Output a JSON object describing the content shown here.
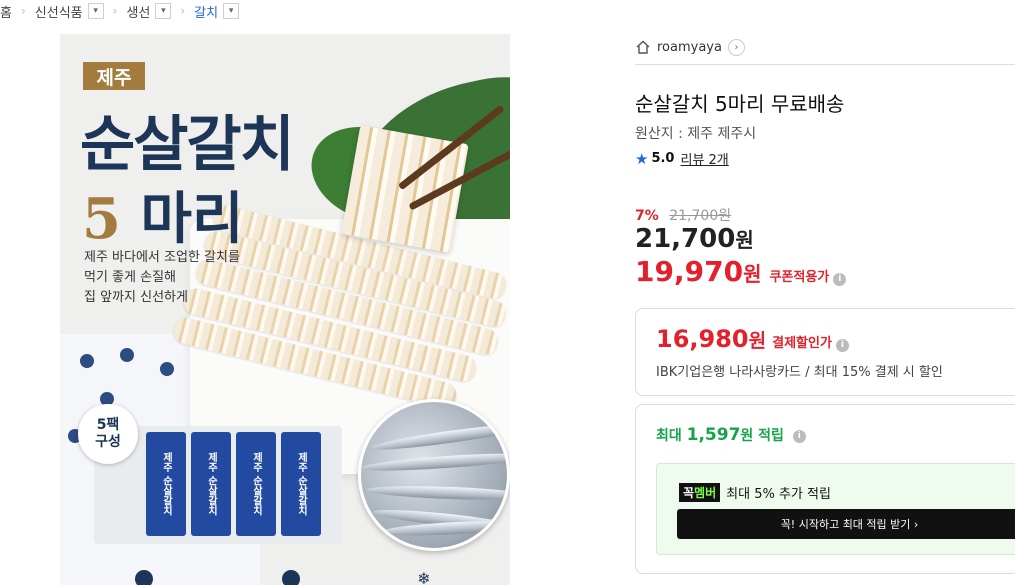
{
  "breadcrumb": {
    "items": [
      "홈",
      "신선식품",
      "생선",
      "갈치"
    ]
  },
  "hero": {
    "badge": "제주",
    "title": "순살갈치",
    "subtitle_number": "5",
    "subtitle_text": "마리",
    "tagline": [
      "제주 바다에서 조업한 갈치를",
      "먹기 좋게 손질해",
      "집 앞까지 신선하게"
    ],
    "pack_badge": [
      "5팩",
      "구성"
    ],
    "pack_label": "제주 순살갈치"
  },
  "product": {
    "shop_name": "roamyaya",
    "title": "순살갈치 5마리 무료배송",
    "origin": "원산지 : 제주 제주시",
    "rating": "5.0",
    "reviews": "리뷰 2개",
    "discount_pct": "7%",
    "original_price": "21,700원",
    "price": "21,700",
    "price_unit": "원",
    "coupon_price": "19,970",
    "coupon_unit": "원",
    "coupon_label": "쿠폰적용가",
    "card_price": "16,980",
    "card_unit": "원",
    "card_label": "결제할인가",
    "card_desc": "IBK기업은행 나라사랑카드 / 최대 15% 결제 시 할인",
    "points_prefix": "최대 ",
    "points_amount": "1,597",
    "points_suffix": "원 적립",
    "member_tag_a": "꼭",
    "member_tag_b": "멤버",
    "member_text": "최대 5% 추가 적립",
    "member_button": "꼭! 시작하고 최대 적립 받기  ›"
  },
  "colors": {
    "accent_red": "#e4212b",
    "accent_blue": "#1f6cd6",
    "points_green": "#16a34a",
    "navy": "#1d3557"
  }
}
